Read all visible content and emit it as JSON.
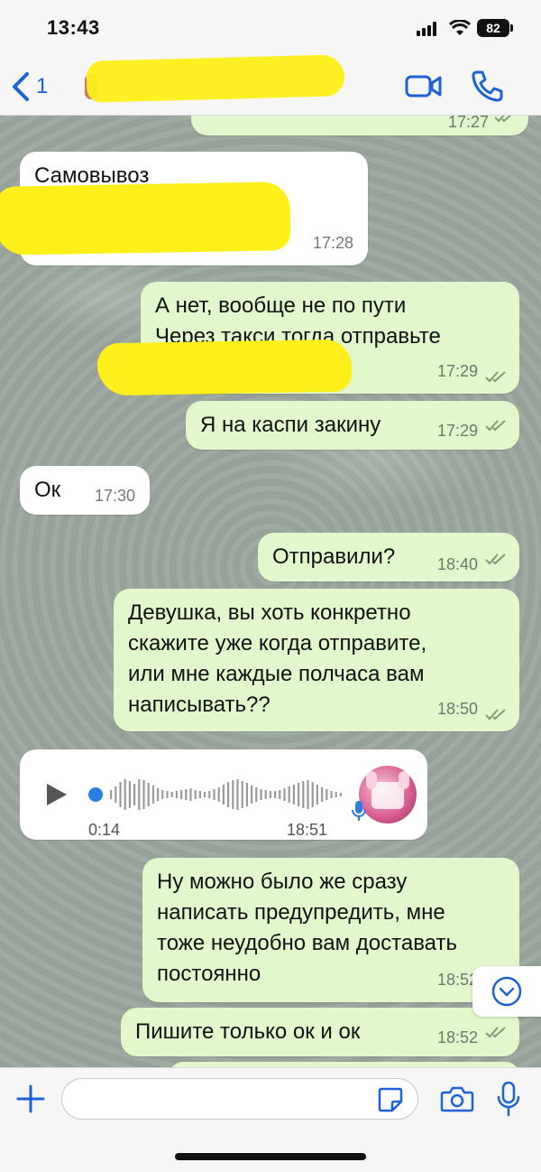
{
  "status_bar": {
    "time": "13:43",
    "battery": "82"
  },
  "header": {
    "back_count": "1"
  },
  "messages": [
    {
      "text": "",
      "time": "17:27"
    },
    {
      "text": "Самовывоз",
      "time": "17:28"
    },
    {
      "text": "А нет, вообще не по пути\nЧерез такси тогда отправьте",
      "time": "17:29"
    },
    {
      "text": "Я на каспи закину",
      "time": "17:29"
    },
    {
      "text": "Ок",
      "time": "17:30"
    },
    {
      "text": "Отправили?",
      "time": "18:40"
    },
    {
      "text": "Девушка, вы хоть конкретно\nскажите уже когда отправите,\nили мне каждые полчаса вам\nнаписывать??",
      "time": "18:50"
    },
    {
      "text": "Ну можно было же сразу\nнаписать предупредить, мне\nтоже неудобно вам доставать\nпостоянно",
      "time": "18:52"
    },
    {
      "text": "Пишите только ок и ок",
      "time": "18:52"
    }
  ],
  "voice_note": {
    "duration": "0:14",
    "time": "18:51"
  },
  "colors": {
    "accent": "#1c62d6",
    "outgoing": "#e2f7cb",
    "incoming": "#ffffff",
    "redaction": "#ffef1a"
  }
}
